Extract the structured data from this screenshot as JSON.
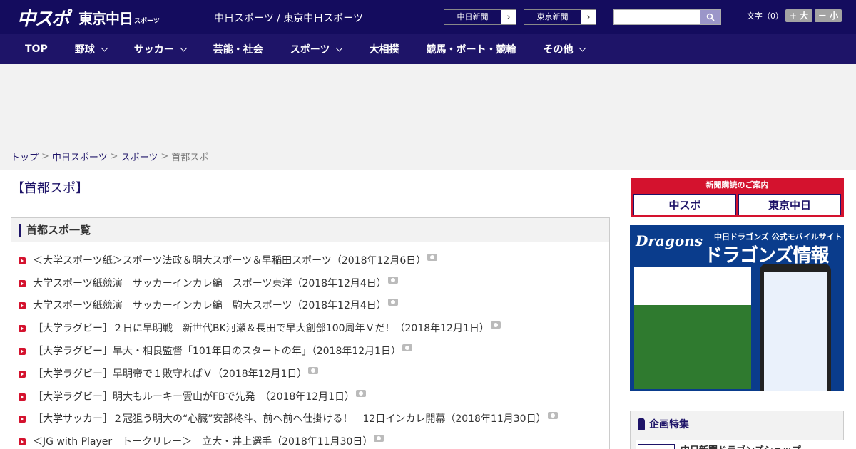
{
  "header": {
    "logo_main": "中スポ",
    "logo_tokyo": "東京中日",
    "logo_tokyo_sub": "スポーツ",
    "site_name": "中日スポーツ / 東京中日スポーツ",
    "paper_links": [
      "中日新聞",
      "東京新聞"
    ],
    "search_placeholder": "",
    "font_size_label": "文字（0）",
    "font_bigger": "+ 大",
    "font_smaller": "－ 小"
  },
  "nav": {
    "items": [
      {
        "label": "TOP",
        "dropdown": false
      },
      {
        "label": "野球",
        "dropdown": true
      },
      {
        "label": "サッカー",
        "dropdown": true
      },
      {
        "label": "芸能・社会",
        "dropdown": false
      },
      {
        "label": "スポーツ",
        "dropdown": true
      },
      {
        "label": "大相撲",
        "dropdown": false
      },
      {
        "label": "競馬・ボート・競輪",
        "dropdown": false
      },
      {
        "label": "その他",
        "dropdown": true
      }
    ]
  },
  "breadcrumb": {
    "items": [
      "トップ",
      "中日スポーツ",
      "スポーツ"
    ],
    "current": "首都スポ"
  },
  "main": {
    "page_title": "【首都スポ】",
    "list_title": "首都スポ一覧",
    "articles": [
      "＜大学スポーツ紙＞スポーツ法政＆明大スポーツ＆早稲田スポーツ（2018年12月6日）",
      "大学スポーツ紙競演　サッカーインカレ編　スポーツ東洋（2018年12月4日）",
      "大学スポーツ紙競演　サッカーインカレ編　駒大スポーツ（2018年12月4日）",
      "［大学ラグビー］２日に早明戦　新世代BK河瀬＆長田で早大創部100周年Ｖだ！（2018年12月1日）",
      "［大学ラグビー］早大・相良監督「101年目のスタートの年」（2018年12月1日）",
      "［大学ラグビー］早明帝で１敗守ればＶ（2018年12月1日）",
      "［大学ラグビー］明大もルーキー雲山がFBで先発　（2018年12月1日）",
      "［大学サッカー］２冠狙う明大の“心臓”安部柊斗、前へ前へ仕掛ける！　12日インカレ開幕（2018年11月30日）",
      "＜JG with Player　トークリレー＞　立大・井上選手（2018年11月30日）"
    ]
  },
  "sidebar": {
    "subscription_title": "新聞購読のご案内",
    "subscription_logos": [
      "中スポ",
      "東京中日"
    ],
    "dragons_ad": {
      "brand": "Dragons",
      "subtitle": "中日ドラゴンズ 公式モバイルサイト",
      "title": "ドラゴンズ情報"
    },
    "special_title": "企画特集",
    "special_item": "中日新聞ドラゴンズショップ"
  },
  "colors": {
    "header_bg": "#140c5e",
    "nav_bg": "#1e1468",
    "accent_red": "#d4122e"
  }
}
